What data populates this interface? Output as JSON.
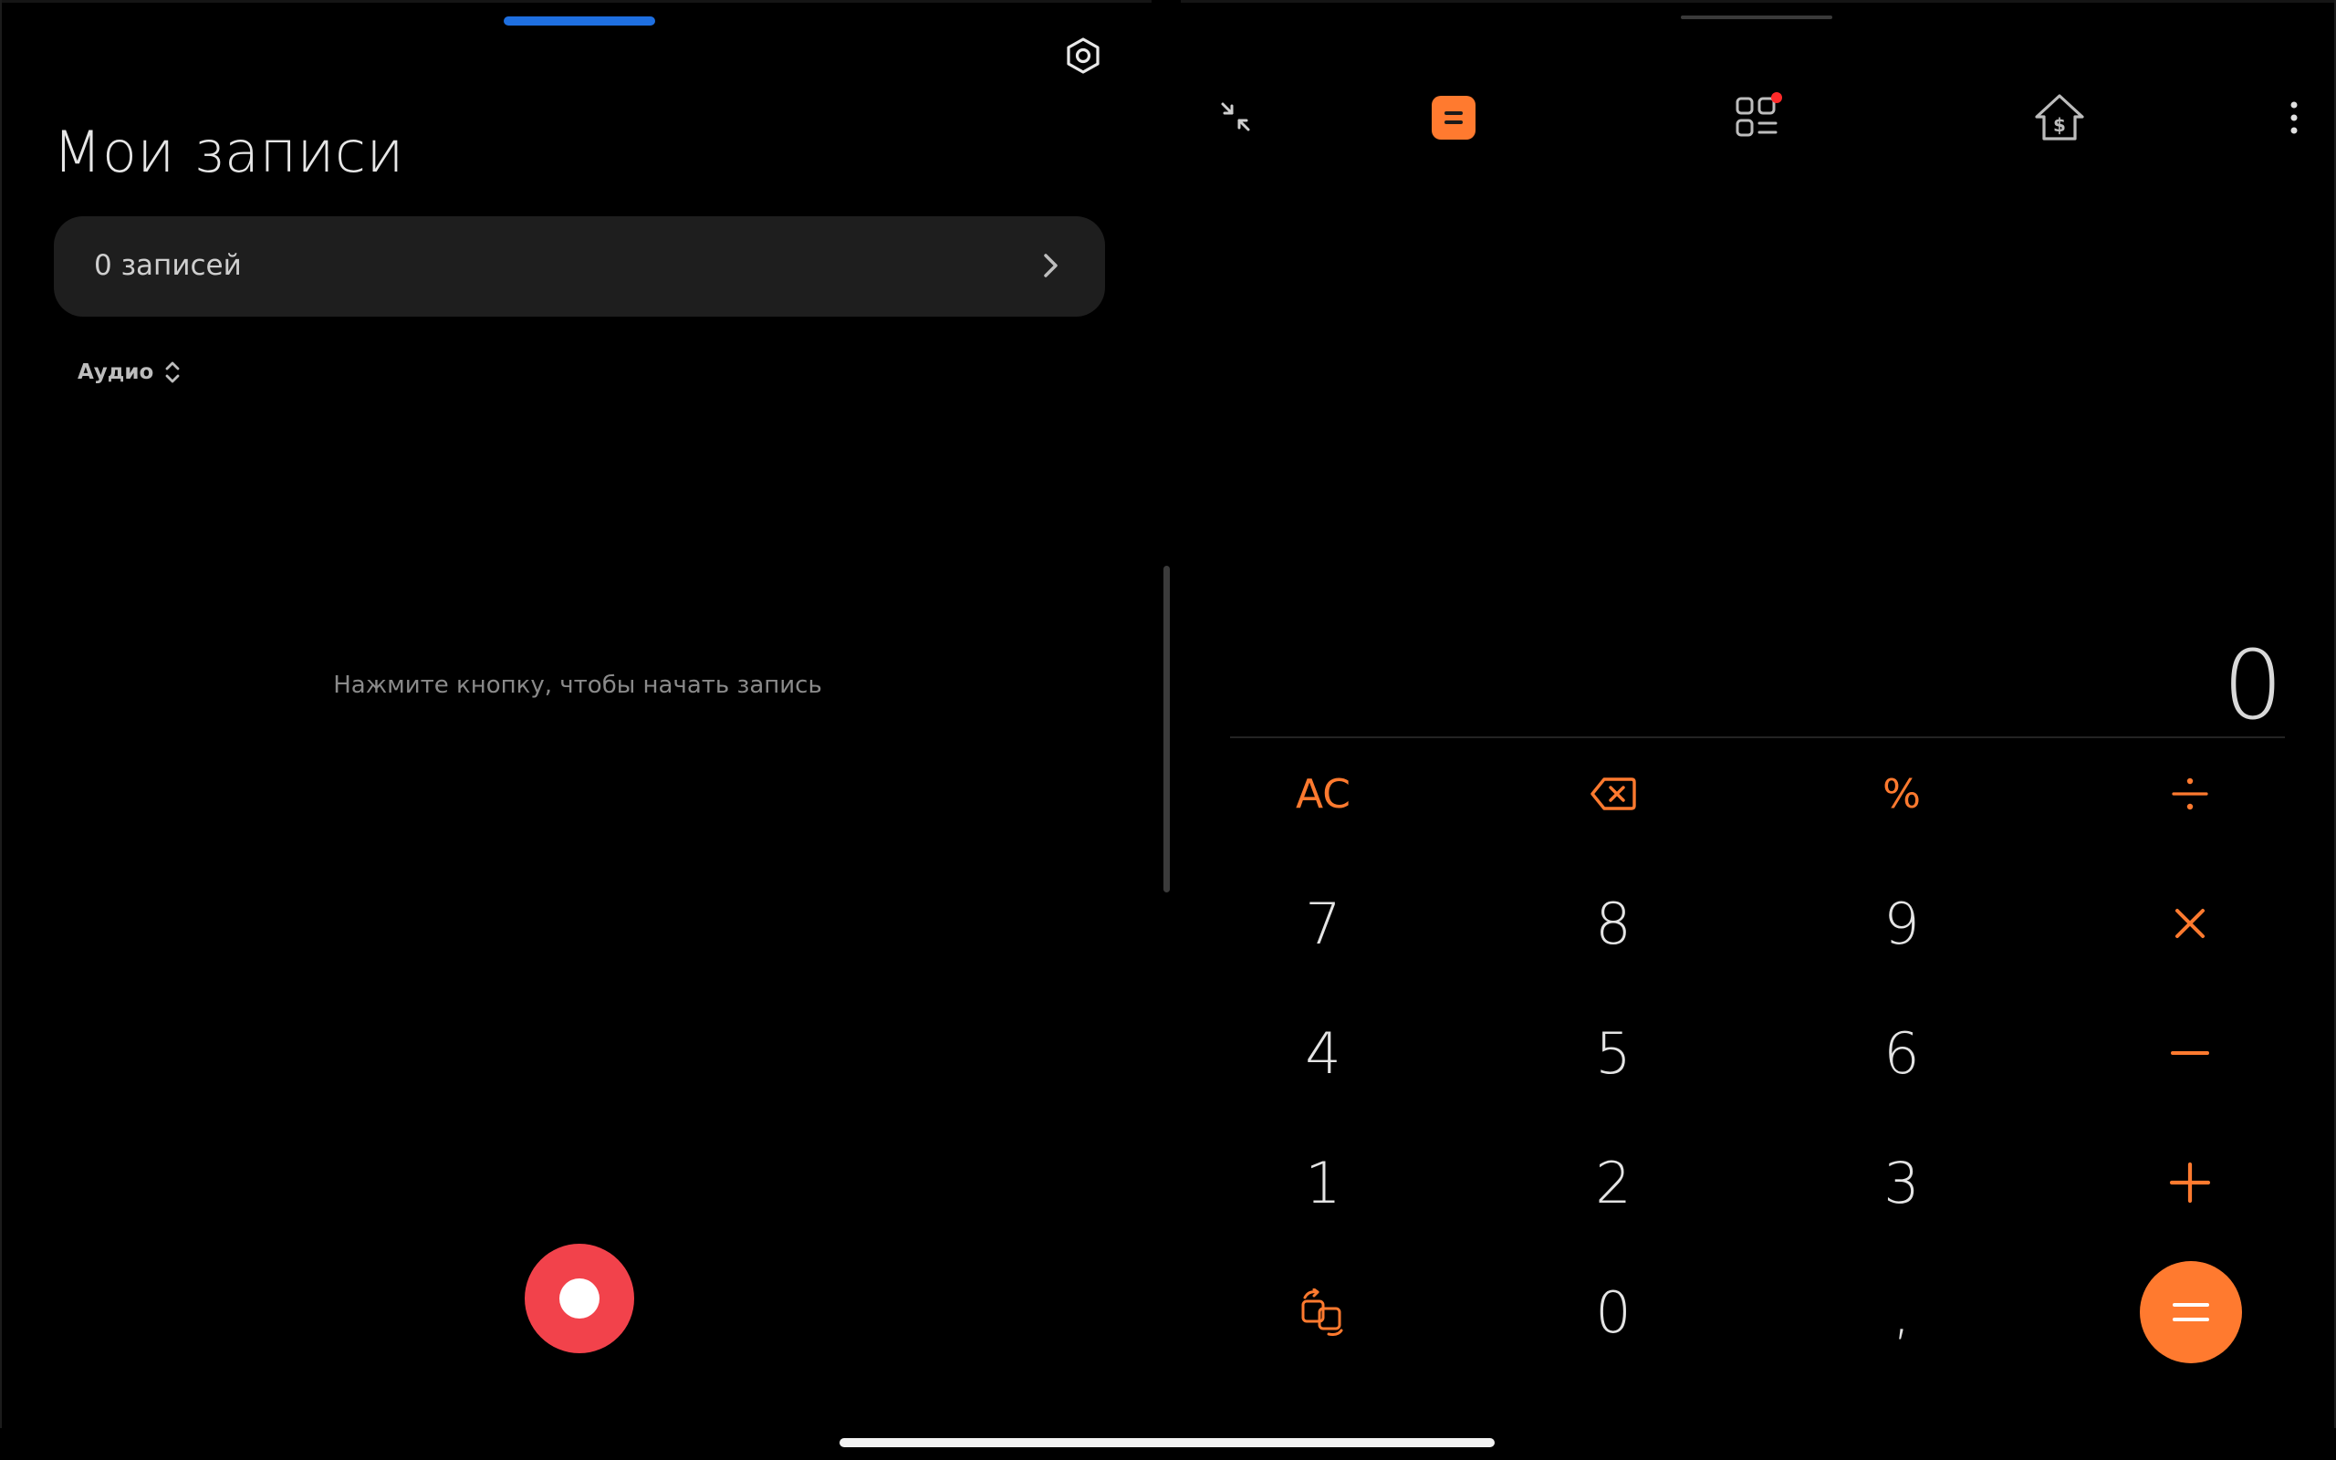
{
  "recorder": {
    "title": "Мои записи",
    "records_count_label": "0 записей",
    "filter_label": "Аудио",
    "empty_hint": "Нажмите кнопку, чтобы начать запись"
  },
  "calculator": {
    "display_value": "0",
    "keys": {
      "ac": "AC",
      "percent": "%",
      "seven": "7",
      "eight": "8",
      "nine": "9",
      "four": "4",
      "five": "5",
      "six": "6",
      "one": "1",
      "two": "2",
      "three": "3",
      "zero": "0",
      "comma": ","
    }
  },
  "colors": {
    "accent_orange": "#ff7a2f",
    "record_red": "#f2424b",
    "active_handle_blue": "#1e6fe0",
    "notification_dot": "#ff2a2a"
  },
  "icons": {
    "settings": "settings-icon",
    "chevron": "chevron-right-icon",
    "sort": "sort-updown-icon",
    "collapse": "collapse-icon",
    "calculator_mode": "calculator-icon",
    "converters": "converters-grid-icon",
    "mortgage": "mortgage-house-icon",
    "more": "more-vert-icon",
    "backspace": "backspace-icon",
    "divide": "divide-icon",
    "multiply": "multiply-icon",
    "minus": "minus-icon",
    "plus": "plus-icon",
    "swap": "swap-functions-icon",
    "equals": "equals-icon"
  }
}
